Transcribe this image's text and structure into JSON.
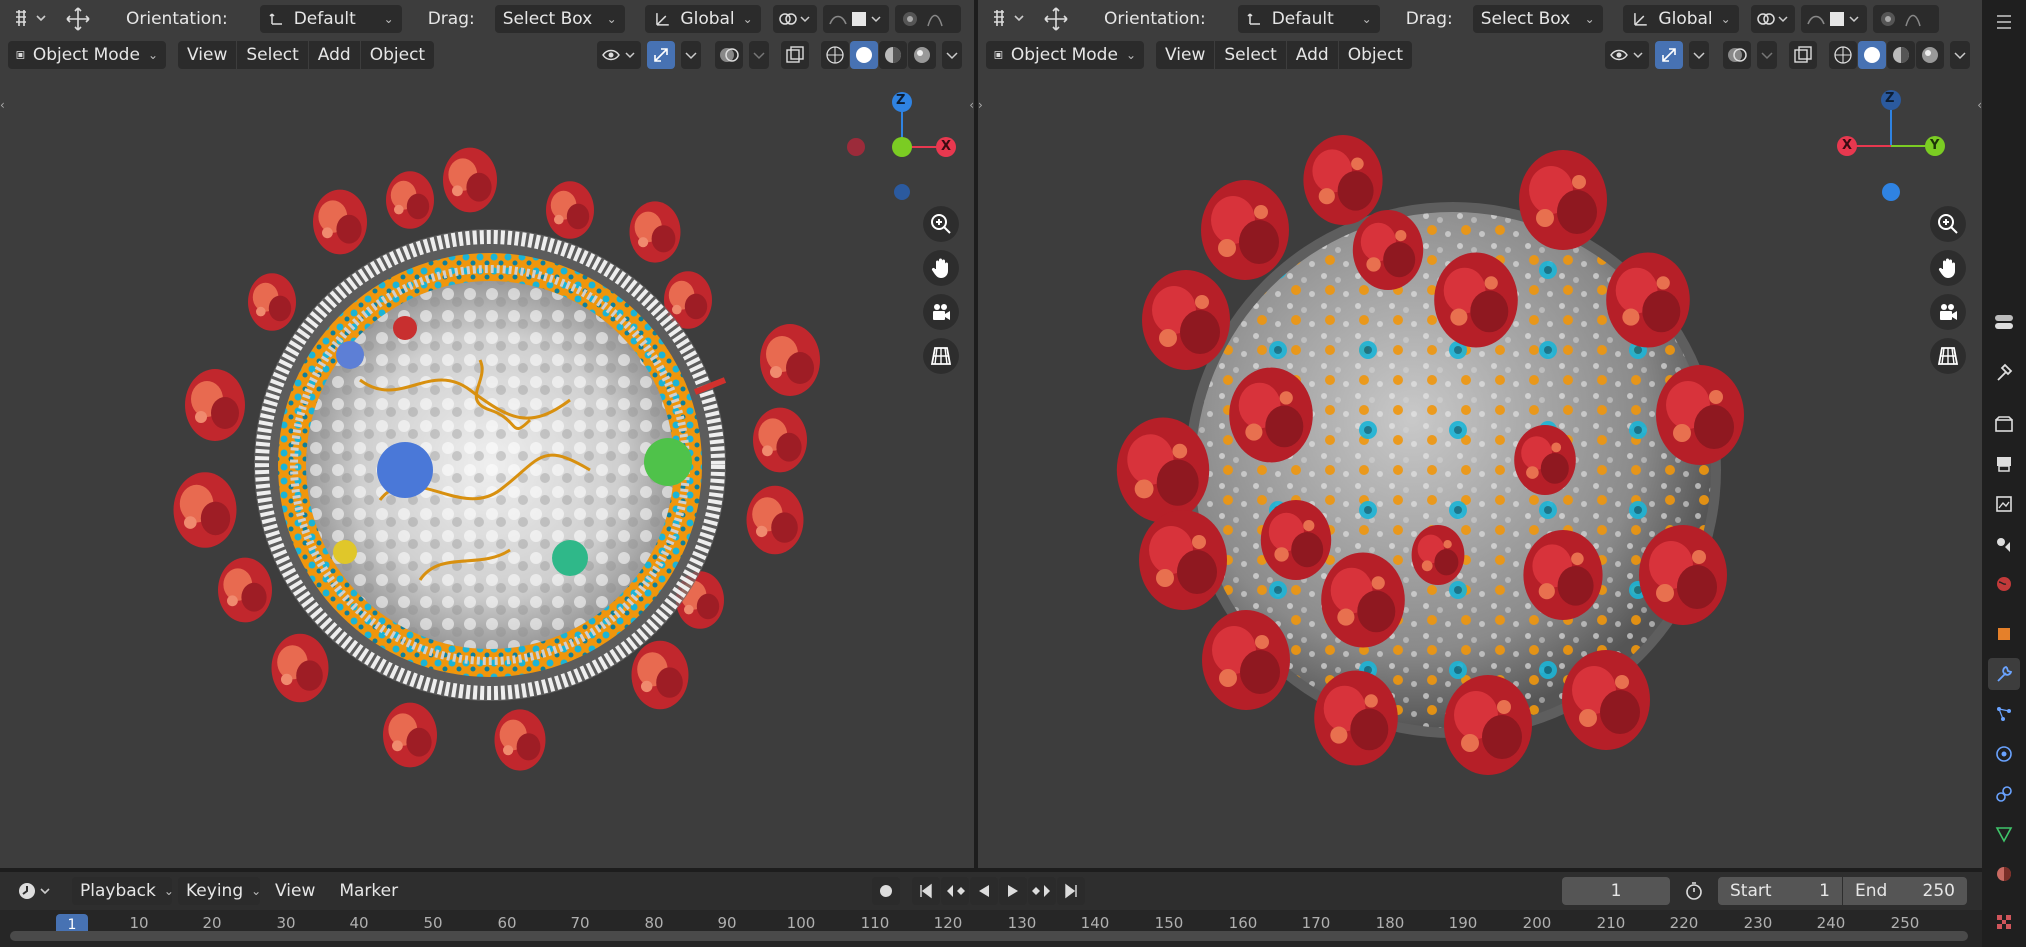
{
  "viewports": [
    {
      "id": "left",
      "header1": {
        "orientation_label": "Orientation:",
        "orientation_value": "Default",
        "drag_label": "Drag:",
        "drag_value": "Select Box",
        "transform_value": "Global"
      },
      "header2": {
        "mode": "Object Mode",
        "menus": [
          "View",
          "Select",
          "Add",
          "Object"
        ]
      },
      "gizmo": {
        "axes": [
          "Z",
          "X"
        ]
      }
    },
    {
      "id": "right",
      "header1": {
        "orientation_label": "Orientation:",
        "orientation_value": "Default",
        "drag_label": "Drag:",
        "drag_value": "Select Box",
        "transform_value": "Global"
      },
      "header2": {
        "mode": "Object Mode",
        "menus": [
          "View",
          "Select",
          "Add",
          "Object"
        ]
      },
      "gizmo": {
        "axes": [
          "Z",
          "X",
          "Y"
        ]
      }
    }
  ],
  "timeline": {
    "menus": [
      "Playback",
      "Keying",
      "View",
      "Marker"
    ],
    "current_frame": "1",
    "start_label": "Start",
    "start_value": "1",
    "end_label": "End",
    "end_value": "250",
    "ruler_ticks": [
      "1",
      "10",
      "20",
      "30",
      "40",
      "50",
      "60",
      "70",
      "80",
      "90",
      "100",
      "110",
      "120",
      "130",
      "140",
      "150",
      "160",
      "170",
      "180",
      "190",
      "200",
      "210",
      "220",
      "230",
      "240",
      "250"
    ]
  },
  "colors": {
    "spike_dark": "#c1272d",
    "spike_light": "#e86a50",
    "membrane_orange": "#f0960c",
    "membrane_cyan": "#1bb4d6",
    "core_white": "#d9d9d9",
    "axis_x": "#e8384f",
    "axis_y": "#7bcc23",
    "axis_z": "#2f83e2",
    "accent_blue": "#4772b3"
  },
  "icons": [
    "editor-type-icon",
    "transform-icon",
    "orientation-icon",
    "transform-pivot-icon",
    "snap-icon",
    "proportional-edit-icon",
    "visibility-icon",
    "gizmo-icon",
    "overlay-icon",
    "xray-icon",
    "shading-wireframe-icon",
    "shading-solid-icon",
    "shading-material-icon",
    "shading-rendered-icon",
    "zoom-icon",
    "hand-pan-icon",
    "camera-icon",
    "grid-view-icon",
    "record-icon",
    "jump-start-icon",
    "prev-keyframe-icon",
    "play-reverse-icon",
    "play-icon",
    "next-keyframe-icon",
    "jump-end-icon",
    "stopwatch-icon"
  ]
}
